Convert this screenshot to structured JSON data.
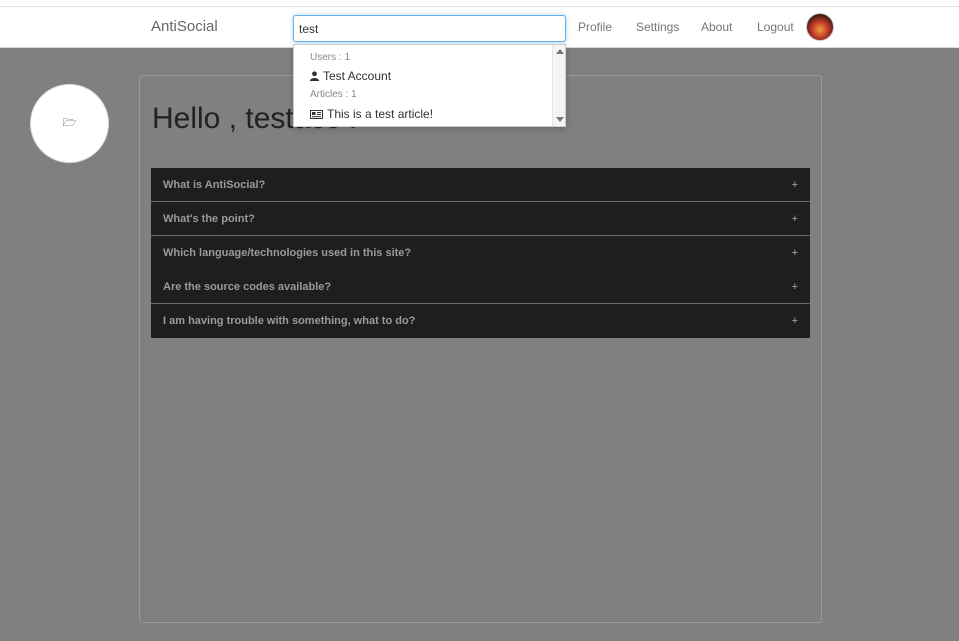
{
  "navbar": {
    "brand": "AntiSocial",
    "search_value": "test",
    "links": [
      "Profile",
      "Settings",
      "About",
      "Logout"
    ]
  },
  "search_dropdown": {
    "users_header": "Users : 1",
    "user_result": "Test Account",
    "articles_header": "Articles : 1",
    "article_result": "This is a test article!"
  },
  "fab": {
    "icon": "folder-open-icon",
    "glyph": "🗁"
  },
  "main": {
    "greeting": "Hello , testacc !",
    "faq": [
      {
        "title": "What is AntiSocial?",
        "toggle": "+"
      },
      {
        "title": "What's the point?",
        "toggle": "+"
      },
      {
        "title": "Which language/technologies used in this site?",
        "toggle": "+"
      },
      {
        "title": "Are the source codes available?",
        "toggle": "+"
      },
      {
        "title": "I am having trouble with something, what to do?",
        "toggle": "+"
      }
    ]
  }
}
